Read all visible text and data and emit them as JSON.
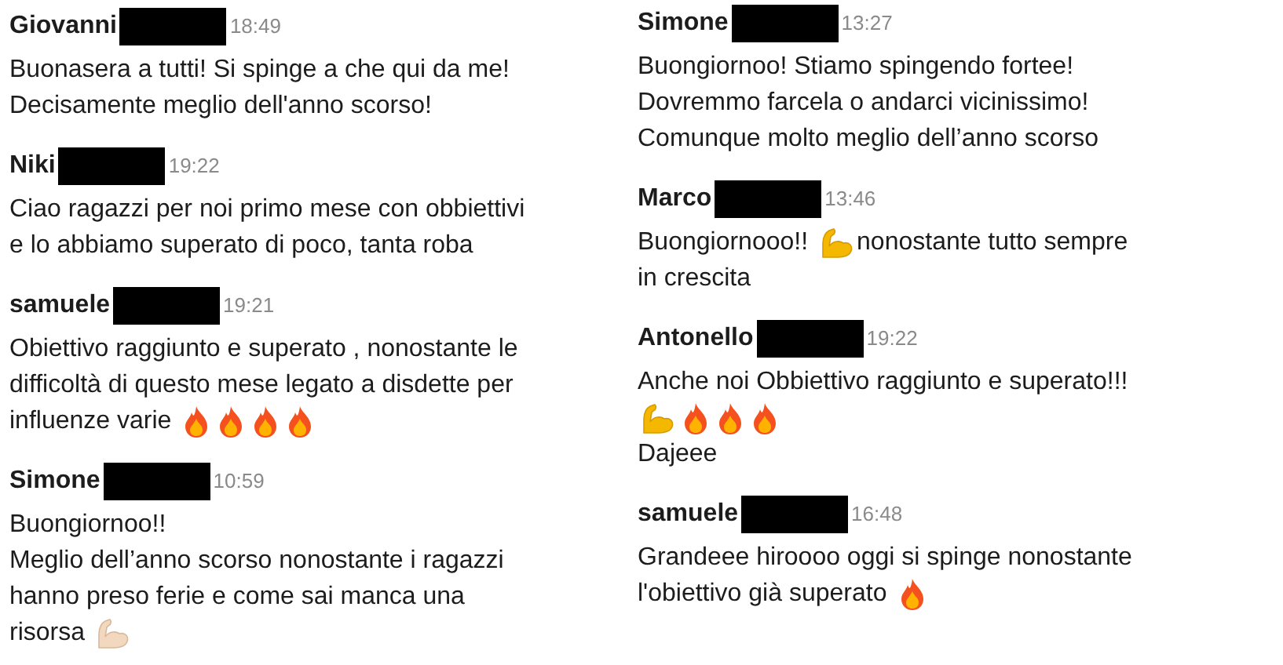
{
  "columns": [
    {
      "messages": [
        {
          "author": "Giovanni",
          "time": "18:49",
          "lines": [
            [
              {
                "kind": "text",
                "text": "Buonasera a tutti! Si spinge a che qui da me!"
              }
            ],
            [
              {
                "kind": "text",
                "text": "Decisamente meglio dell'anno scorso!"
              }
            ]
          ]
        },
        {
          "author": "Niki",
          "time": "19:22",
          "lines": [
            [
              {
                "kind": "text",
                "text": "Ciao ragazzi per noi primo mese con obbiettivi"
              }
            ],
            [
              {
                "kind": "text",
                "text": "e lo abbiamo superato di poco, tanta roba"
              }
            ]
          ]
        },
        {
          "author": "samuele",
          "time": "19:21",
          "lines": [
            [
              {
                "kind": "text",
                "text": "Obiettivo raggiunto e superato , nonostante le"
              }
            ],
            [
              {
                "kind": "text",
                "text": "difficoltà di questo mese legato a disdette per"
              }
            ],
            [
              {
                "kind": "text",
                "text": "influenze varie"
              },
              {
                "kind": "flame"
              },
              {
                "kind": "flame"
              },
              {
                "kind": "flame"
              },
              {
                "kind": "flame"
              }
            ]
          ]
        },
        {
          "author": "Simone",
          "time": "10:59",
          "lines": [
            [
              {
                "kind": "text",
                "text": "Buongiornoo!!"
              }
            ],
            [
              {
                "kind": "text",
                "text": "Meglio dell’anno scorso nonostante i ragazzi"
              }
            ],
            [
              {
                "kind": "text",
                "text": "hanno preso ferie e come sai manca una"
              }
            ],
            [
              {
                "kind": "text",
                "text": "risorsa"
              },
              {
                "kind": "arm-pale"
              }
            ]
          ]
        }
      ]
    },
    {
      "messages": [
        {
          "author": "Simone",
          "time": "13:27",
          "lines": [
            [
              {
                "kind": "text",
                "text": "Buongiornoo! Stiamo spingendo fortee!"
              }
            ],
            [
              {
                "kind": "text",
                "text": "Dovremmo farcela o andarci vicinissimo!"
              }
            ],
            [
              {
                "kind": "text",
                "text": "Comunque molto meglio dell’anno scorso"
              }
            ]
          ]
        },
        {
          "author": "Marco",
          "time": "13:46",
          "lines": [
            [
              {
                "kind": "text",
                "text": "Buongiornooo!!"
              },
              {
                "kind": "arm"
              },
              {
                "kind": "text",
                "text": "nonostante tutto sempre"
              }
            ],
            [
              {
                "kind": "text",
                "text": "in crescita"
              }
            ]
          ]
        },
        {
          "author": "Antonello",
          "time": "19:22",
          "lines": [
            [
              {
                "kind": "text",
                "text": "Anche noi Obbiettivo raggiunto e superato!!!"
              }
            ],
            [
              {
                "kind": "arm"
              },
              {
                "kind": "flame"
              },
              {
                "kind": "flame"
              },
              {
                "kind": "flame"
              }
            ],
            [
              {
                "kind": "text",
                "text": "Dajeee"
              }
            ]
          ]
        },
        {
          "author": "samuele",
          "time": "16:48",
          "lines": [
            [
              {
                "kind": "text",
                "text": "Grandeee hiroooo oggi si spinge nonostante"
              }
            ],
            [
              {
                "kind": "text",
                "text": "l'obiettivo già superato"
              },
              {
                "kind": "flame"
              }
            ]
          ]
        }
      ]
    }
  ]
}
